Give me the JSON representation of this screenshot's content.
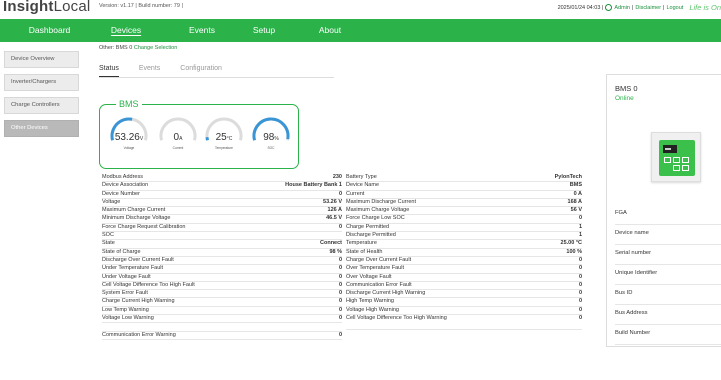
{
  "header": {
    "logo_bold": "Insight",
    "logo_light": "Local",
    "version": "Version: v1.17 | Build number: 79 |",
    "datetime": "2025/01/24 04:03 |",
    "user": "Admin",
    "sep1": "|",
    "disclaimer": "Disclaimer",
    "sep2": "|",
    "logout": "Logout",
    "tagline": "Life is On"
  },
  "nav": {
    "items": [
      {
        "label": "Dashboard"
      },
      {
        "label": "Devices"
      },
      {
        "label": "Events"
      },
      {
        "label": "Setup"
      },
      {
        "label": "About"
      }
    ],
    "active": "Devices"
  },
  "sidebar": {
    "items": [
      {
        "label": "Device Overview"
      },
      {
        "label": "Inverter/Chargers"
      },
      {
        "label": "Charge Controllers"
      },
      {
        "label": "Other Devices"
      }
    ]
  },
  "breadcrumb": {
    "text": "Other: BMS 0",
    "link": "Change Selection"
  },
  "tabs": [
    {
      "label": "Status"
    },
    {
      "label": "Events"
    },
    {
      "label": "Configuration"
    }
  ],
  "bms_card": {
    "title": "BMS",
    "gauges": [
      {
        "value": "53.26",
        "unit": "V",
        "label": "Voltage",
        "fraction": 0.55,
        "color": "#3a95d6"
      },
      {
        "value": "0",
        "unit": "A",
        "label": "Current",
        "fraction": 0.0,
        "color": "#3a95d6"
      },
      {
        "value": "25",
        "unit": "°C",
        "label": "Temperature",
        "fraction": 0.05,
        "color": "#3a95d6"
      },
      {
        "value": "98",
        "unit": "%",
        "label": "SOC",
        "fraction": 0.98,
        "color": "#3a95d6"
      }
    ]
  },
  "left_table": [
    {
      "k": "Modbus Address",
      "v": "230"
    },
    {
      "k": "Device Association",
      "v": "House Battery Bank 1"
    },
    {
      "k": "Device Number",
      "v": "0"
    },
    {
      "k": "Voltage",
      "v": "53.26 V"
    },
    {
      "k": "Maximum Charge Current",
      "v": "126 A"
    },
    {
      "k": "Minimum Discharge Voltage",
      "v": "46.5 V"
    },
    {
      "k": "Force Charge Request Calibration",
      "v": "0"
    },
    {
      "k": "SOC",
      "v": ""
    },
    {
      "k": "State",
      "v": "Connect"
    },
    {
      "k": "State of Charge",
      "v": "98 %"
    },
    {
      "k": "Discharge Over Current Fault",
      "v": "0"
    },
    {
      "k": "Under Temperature Fault",
      "v": "0"
    },
    {
      "k": "Under Voltage Fault",
      "v": "0"
    },
    {
      "k": "Cell Voltage Difference Too High Fault",
      "v": "0"
    },
    {
      "k": "System Error Fault",
      "v": "0"
    },
    {
      "k": "Charge Current High Warning",
      "v": "0"
    },
    {
      "k": "Low Temp Warning",
      "v": "0"
    },
    {
      "k": "Voltage Low Warning",
      "v": "0"
    },
    {
      "k": "",
      "v": ""
    },
    {
      "k": "Communication Error Warning",
      "v": "0"
    }
  ],
  "right_table": [
    {
      "k": "Battery Type",
      "v": "PylonTech"
    },
    {
      "k": "Device Name",
      "v": "BMS"
    },
    {
      "k": "Current",
      "v": "0 A"
    },
    {
      "k": "Maximum Discharge Current",
      "v": "168 A"
    },
    {
      "k": "Maximum Charge Voltage",
      "v": "56 V"
    },
    {
      "k": "Force Charge Low SOC",
      "v": "0"
    },
    {
      "k": "Charge Permitted",
      "v": "1"
    },
    {
      "k": "Discharge Permitted",
      "v": "1"
    },
    {
      "k": "Temperature",
      "v": "25.00 °C"
    },
    {
      "k": "State of Health",
      "v": "100 %"
    },
    {
      "k": "Charge Over Current Fault",
      "v": "0"
    },
    {
      "k": "Over Temperature Fault",
      "v": "0"
    },
    {
      "k": "Over Voltage Fault",
      "v": "0"
    },
    {
      "k": "Communication Error Fault",
      "v": "0"
    },
    {
      "k": "Discharge Current High Warning",
      "v": "0"
    },
    {
      "k": "High Temp Warning",
      "v": "0"
    },
    {
      "k": "Voltage High Warning",
      "v": "0"
    },
    {
      "k": "Cell Voltage Difference Too High Warning",
      "v": "0"
    }
  ],
  "info_panel": {
    "title": "BMS 0",
    "status": "Online",
    "rows": [
      {
        "label": "FGA"
      },
      {
        "label": "Device name"
      },
      {
        "label": "Serial number"
      },
      {
        "label": "Unique Identifier"
      },
      {
        "label": "Bus ID"
      },
      {
        "label": "Bus Address"
      },
      {
        "label": "Build Number"
      }
    ]
  }
}
